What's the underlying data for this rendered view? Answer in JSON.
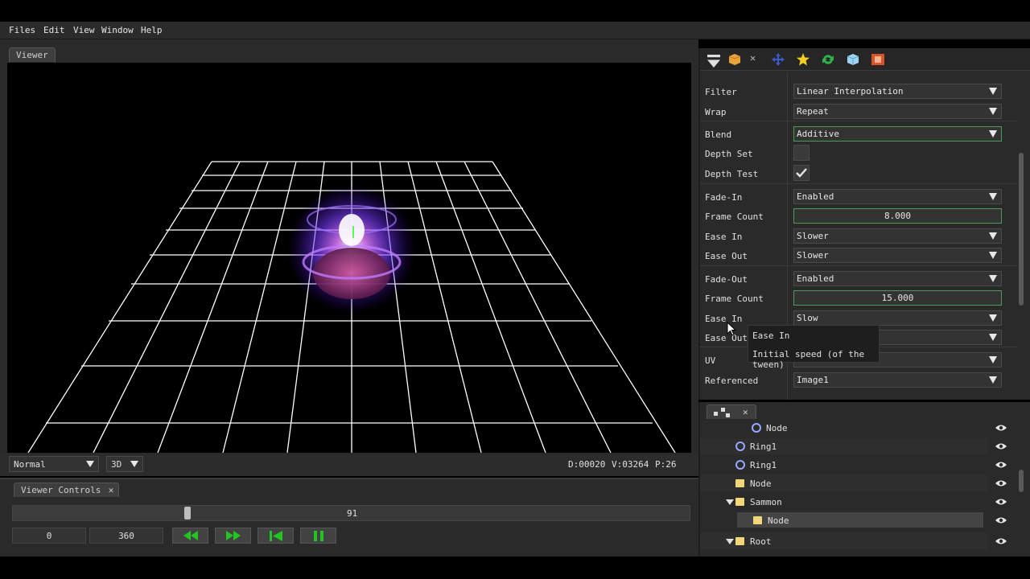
{
  "menu": [
    "Files",
    "Edit",
    "View",
    "Window",
    "Help"
  ],
  "viewer": {
    "tab_label": "Viewer",
    "mode": "Normal",
    "dim": "3D",
    "status_d": "D:00020",
    "status_v": "V:03264",
    "status_p": "P:26"
  },
  "controls": {
    "tab_label": "Viewer Controls",
    "close_glyph": "✕",
    "current_frame": "91",
    "frame_fraction": 0.253,
    "start_frame": "0",
    "end_frame": "360"
  },
  "properties": [
    {
      "label": "Filter",
      "type": "combo",
      "value": "Linear Interpolation",
      "hl": false
    },
    {
      "label": "Wrap",
      "type": "combo",
      "value": "Repeat",
      "hl": false
    },
    {
      "label": "Blend",
      "type": "combo",
      "value": "Additive",
      "hl": true
    },
    {
      "label": "Depth Set",
      "type": "check",
      "value": false
    },
    {
      "label": "Depth Test",
      "type": "check",
      "value": true
    },
    {
      "label": "Fade-In",
      "type": "combo",
      "value": "Enabled",
      "hl": false
    },
    {
      "label": "Frame Count",
      "type": "num",
      "value": "8.000"
    },
    {
      "label": "Ease In",
      "type": "combo",
      "value": "Slower",
      "hl": false
    },
    {
      "label": "Ease Out",
      "type": "combo",
      "value": "Slower",
      "hl": false
    },
    {
      "label": "Fade-Out",
      "type": "combo",
      "value": "Enabled",
      "hl": false
    },
    {
      "label": "Frame Count",
      "type": "num",
      "value": "15.000"
    },
    {
      "label": "Ease In",
      "type": "combo",
      "value": "Slow",
      "hl": false
    },
    {
      "label": "Ease Out",
      "type": "combo",
      "value": "",
      "hl": false
    },
    {
      "label": "UV",
      "type": "combo",
      "value": "",
      "hl": false
    },
    {
      "label": "Referenced",
      "type": "combo",
      "value": "Image1",
      "hl": false
    }
  ],
  "tooltip": {
    "title": "Ease In",
    "desc": "Initial speed (of the tween)"
  },
  "tree": {
    "tab_close": "✕",
    "rows": [
      {
        "label": "Node",
        "icon": "ring"
      },
      {
        "label": "Ring1",
        "icon": "ring"
      },
      {
        "label": "Ring1",
        "icon": "ring"
      },
      {
        "label": "Node",
        "icon": "folder"
      },
      {
        "label": "Sammon",
        "icon": "folder"
      },
      {
        "label": "Node",
        "icon": "folder"
      },
      {
        "label": "Root",
        "icon": "folder"
      }
    ]
  },
  "colors": {
    "accent_green": "#4a9a5a",
    "folder_yellow": "#f1d77a",
    "ring_blue": "#9aa7ff",
    "play_green": "#22c322"
  }
}
